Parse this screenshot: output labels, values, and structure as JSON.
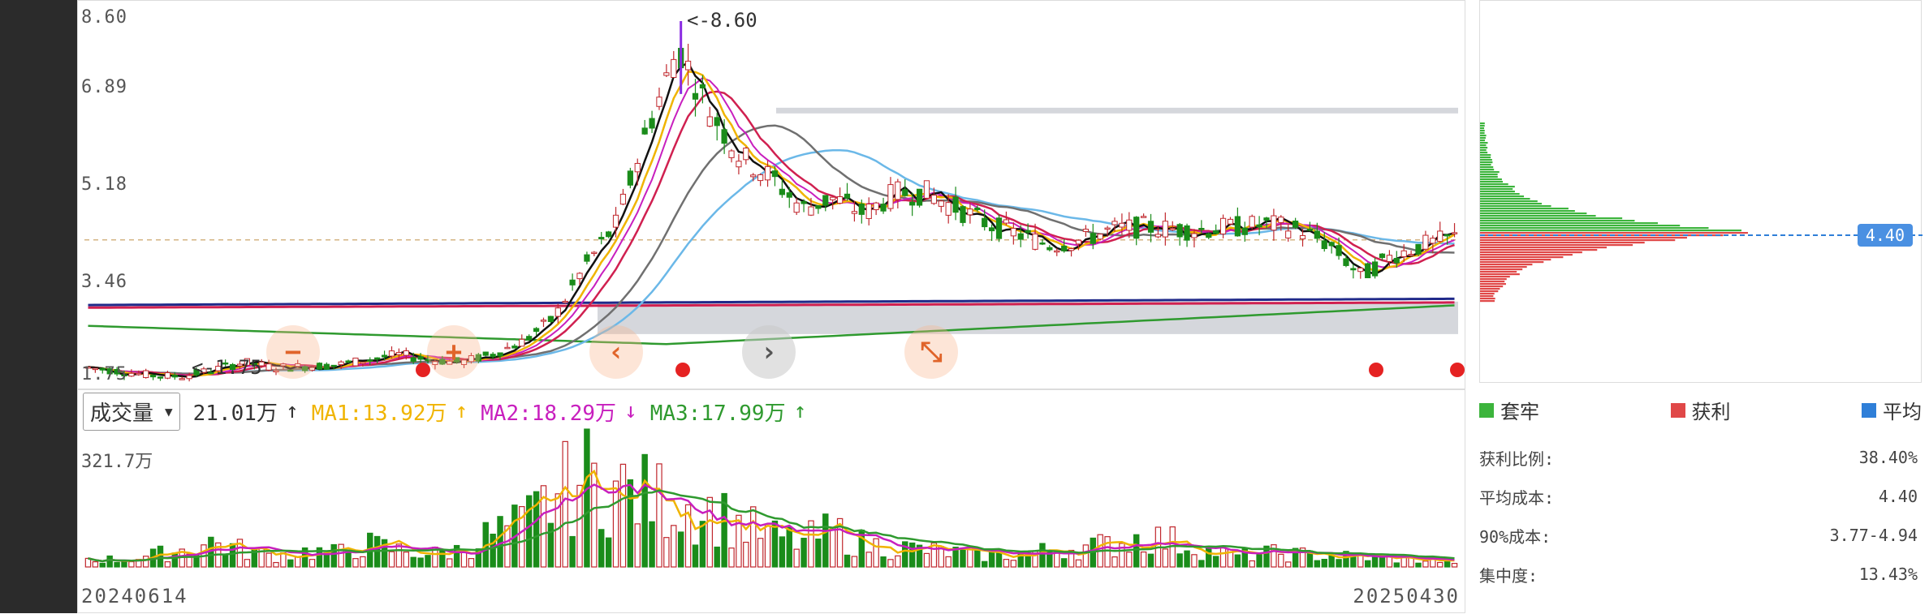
{
  "price_axis": {
    "labels": [
      "8.60",
      "6.89",
      "5.18",
      "3.46",
      "1.75"
    ]
  },
  "annotations": {
    "high_label": "<-8.60",
    "low_label": "<-1.75"
  },
  "controls": {
    "zoom_out": "−",
    "zoom_in": "+",
    "prev": "‹",
    "next": "›",
    "shrink": "⤡"
  },
  "icons": {
    "zoom_out": "minus-icon",
    "zoom_in": "plus-icon",
    "prev": "chevron-left-icon",
    "next": "chevron-right-icon",
    "shrink": "collapse-icon",
    "dropdown": "caret-down-icon"
  },
  "volume": {
    "selector_label": "成交量",
    "current": "21.01万",
    "current_dir": "↑",
    "ma1": "MA1:13.92万",
    "ma1_dir": "↑",
    "ma2": "MA2:18.29万",
    "ma2_dir": "↓",
    "ma3": "MA3:17.99万",
    "ma3_dir": "↑",
    "max_label": "321.7万"
  },
  "dates": {
    "start": "20240614",
    "end": "20250430"
  },
  "chip": {
    "avg_badge": "4.40",
    "legend": [
      {
        "label": "套牢",
        "color": "#3cb43c"
      },
      {
        "label": "获利",
        "color": "#e04848"
      },
      {
        "label": "平均",
        "color": "#2f7fd8"
      }
    ],
    "stats": [
      {
        "label": "获利比例:",
        "value": "38.40%"
      },
      {
        "label": "平均成本:",
        "value": "4.40"
      },
      {
        "label": "90%成本:",
        "value": "3.77-4.94"
      },
      {
        "label": "集中度:",
        "value": "13.43%"
      }
    ]
  },
  "colors": {
    "up": "#c0272d",
    "down": "#1a8c1a",
    "ma_fast": "#111111",
    "ma_yellow": "#f0b400",
    "ma_magenta": "#c81fbe",
    "ma_red": "#d02050",
    "ma_gray": "#707070",
    "ma_blue": "#6bb8e8",
    "ma_green": "#2f9a2f",
    "ma_navy": "#202a8a"
  },
  "chart_data": {
    "type": "candlestick",
    "x_range": [
      "20240614",
      "20250430"
    ],
    "ylim": [
      1.75,
      8.6
    ],
    "y_ticks": [
      1.75,
      3.46,
      5.18,
      6.89,
      8.6
    ],
    "price_close_approx": [
      1.95,
      1.88,
      1.8,
      1.78,
      1.9,
      2.05,
      1.95,
      1.97,
      2.0,
      2.1,
      2.2,
      2.1,
      2.05,
      2.2,
      2.45,
      2.9,
      3.9,
      4.7,
      6.5,
      8.1,
      6.9,
      6.0,
      5.6,
      5.0,
      5.2,
      4.9,
      5.3,
      5.3,
      5.0,
      4.7,
      4.5,
      4.3,
      4.4,
      4.6,
      4.65,
      4.6,
      4.6,
      4.65,
      4.7,
      4.6,
      4.3,
      3.7,
      4.1,
      4.3,
      4.45
    ],
    "volume_max": "321.7万",
    "volume_approx_wan": [
      30,
      25,
      40,
      60,
      90,
      60,
      40,
      55,
      50,
      80,
      60,
      45,
      60,
      120,
      150,
      250,
      321,
      280,
      250,
      230,
      200,
      150,
      110,
      90,
      130,
      80,
      70,
      60,
      50,
      40,
      45,
      60,
      70,
      80,
      110,
      90,
      60,
      40,
      50,
      45,
      40,
      35,
      30,
      25,
      21
    ]
  }
}
